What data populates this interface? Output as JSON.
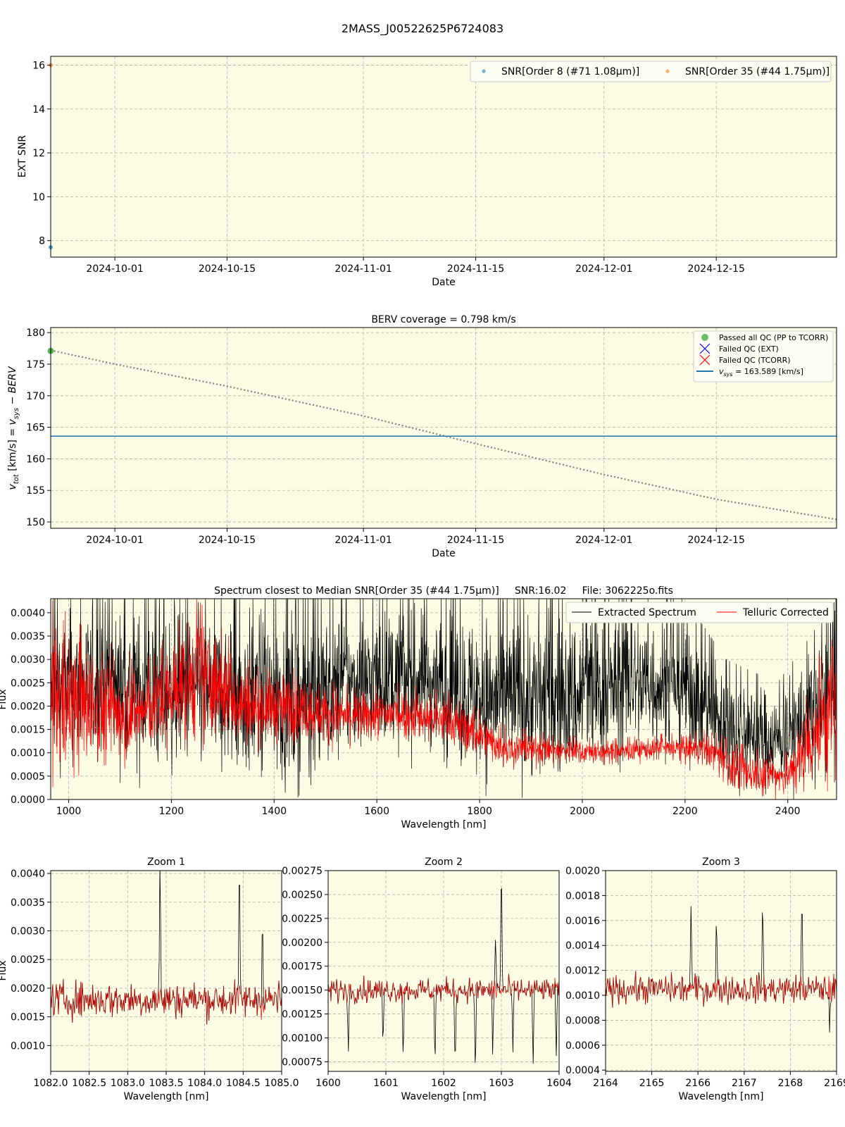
{
  "figure_title": "2MASS_J00522625P6724083",
  "colors": {
    "panel_bg": "#fcfbe3",
    "series_blue": "#1f77b4",
    "series_orange": "#ff7f0e",
    "spec_black": "#000000",
    "spec_red": "#ff0000",
    "grid": "#b0b0b0",
    "passed_green": "#2ca02c",
    "vsys_line": "#1f77b4",
    "berv_curve": "#808080"
  },
  "chart_data": [
    {
      "id": "snr",
      "type": "scatter",
      "title": "",
      "xlabel": "Date",
      "ylabel": "EXT SNR",
      "x_range": [
        "2024-09-23",
        "2024-12-30"
      ],
      "ylim": [
        7.25,
        16.4
      ],
      "x_ticks": [
        "2024-10-01",
        "2024-10-15",
        "2024-11-01",
        "2024-11-15",
        "2024-12-01",
        "2024-12-15"
      ],
      "y_ticks": [
        8,
        10,
        12,
        14,
        16
      ],
      "grid": true,
      "legend_position": "top-right",
      "series": [
        {
          "name": "SNR[Order 8 (#71 1.08μm)]",
          "color": "#1f77b4",
          "points": [
            {
              "x": "2024-09-23",
              "y": 7.7
            }
          ]
        },
        {
          "name": "SNR[Order 35 (#44 1.75μm)]",
          "color": "#ff7f0e",
          "points": [
            {
              "x": "2024-09-23",
              "y": 16.0
            }
          ]
        }
      ]
    },
    {
      "id": "berv",
      "type": "line",
      "title": "BERV coverage = 0.798 km/s",
      "xlabel": "Date",
      "ylabel": "v_tot [km/s] = v_sys − BERV",
      "x_range": [
        "2024-09-23",
        "2024-12-30"
      ],
      "ylim": [
        149,
        180.8
      ],
      "x_ticks": [
        "2024-10-01",
        "2024-10-15",
        "2024-11-01",
        "2024-11-15",
        "2024-12-01",
        "2024-12-15"
      ],
      "y_ticks": [
        150,
        155,
        160,
        165,
        170,
        175,
        180
      ],
      "grid": true,
      "legend_position": "top-right",
      "legend": [
        "Passed all QC (PP to TCORR)",
        "Failed QC (EXT)",
        "Failed QC (TCORR)",
        "v_sys = 163.589 [km/s]"
      ],
      "vsys": 163.589,
      "passed_points": [
        {
          "x": "2024-09-23",
          "y": 177.1
        }
      ],
      "berv_curve": [
        {
          "x": "2024-09-23",
          "y": 177.2
        },
        {
          "x": "2024-10-01",
          "y": 175.0
        },
        {
          "x": "2024-10-15",
          "y": 171.5
        },
        {
          "x": "2024-11-01",
          "y": 166.8
        },
        {
          "x": "2024-11-15",
          "y": 162.4
        },
        {
          "x": "2024-12-01",
          "y": 157.5
        },
        {
          "x": "2024-12-15",
          "y": 153.6
        },
        {
          "x": "2024-12-30",
          "y": 150.4
        }
      ]
    },
    {
      "id": "spectrum",
      "type": "line",
      "title": "Spectrum closest to Median SNR[Order 35 (#44 1.75μm)]     SNR:16.02     File: 3062225o.fits",
      "xlabel": "Wavelength [nm]",
      "ylabel": "Flux",
      "xlim": [
        965,
        2495
      ],
      "ylim": [
        0,
        0.0043
      ],
      "x_ticks": [
        1000,
        1200,
        1400,
        1600,
        1800,
        2000,
        2200,
        2400
      ],
      "y_ticks": [
        "0.0000",
        "0.0005",
        "0.0010",
        "0.0015",
        "0.0020",
        "0.0025",
        "0.0030",
        "0.0035",
        "0.0040"
      ],
      "grid": true,
      "legend_position": "top-right",
      "series": [
        {
          "name": "Extracted Spectrum",
          "color": "#000000",
          "envelope": [
            [
              965,
              0.0005,
              0.0043
            ],
            [
              1100,
              0.0006,
              0.0043
            ],
            [
              1150,
              0.0002,
              0.0043
            ],
            [
              1250,
              0.0004,
              0.0043
            ],
            [
              1350,
              0.0,
              0.0043
            ],
            [
              1450,
              0.0,
              0.0043
            ],
            [
              1520,
              0.0004,
              0.0043
            ],
            [
              1600,
              0.0008,
              0.0043
            ],
            [
              1700,
              0.0008,
              0.0043
            ],
            [
              1800,
              0.0,
              0.0043
            ],
            [
              1900,
              0.0,
              0.0043
            ],
            [
              2000,
              0.0001,
              0.0043
            ],
            [
              2100,
              0.0007,
              0.0043
            ],
            [
              2200,
              0.0006,
              0.0043
            ],
            [
              2280,
              0.0,
              0.003
            ],
            [
              2380,
              0.0,
              0.0025
            ],
            [
              2495,
              0.0,
              0.0043
            ]
          ]
        },
        {
          "name": "Telluric Corrected",
          "color": "#ff0000",
          "envelope": [
            [
              965,
              0.0,
              0.0043
            ],
            [
              1050,
              0.0004,
              0.0035
            ],
            [
              1150,
              0.0008,
              0.003
            ],
            [
              1250,
              0.001,
              0.0043
            ],
            [
              1350,
              0.001,
              0.003
            ],
            [
              1450,
              0.0011,
              0.0028
            ],
            [
              1550,
              0.0011,
              0.0024
            ],
            [
              1650,
              0.0012,
              0.0025
            ],
            [
              1750,
              0.001,
              0.0023
            ],
            [
              1850,
              0.0006,
              0.0016
            ],
            [
              1950,
              0.0007,
              0.0014
            ],
            [
              2050,
              0.0007,
              0.0013
            ],
            [
              2150,
              0.0008,
              0.0014
            ],
            [
              2250,
              0.0006,
              0.0015
            ],
            [
              2300,
              0.0,
              0.0012
            ],
            [
              2400,
              0.0,
              0.001
            ],
            [
              2495,
              0.0,
              0.0043
            ]
          ]
        }
      ]
    },
    {
      "id": "zoom1",
      "type": "line",
      "title": "Zoom 1",
      "xlabel": "Wavelength [nm]",
      "ylabel": "Flux",
      "xlim": [
        1082.0,
        1085.0
      ],
      "ylim": [
        0.00055,
        0.00405
      ],
      "x_ticks": [
        "1082.0",
        "1082.5",
        "1083.0",
        "1083.5",
        "1084.0",
        "1084.5",
        "1085.0"
      ],
      "y_ticks": [
        "0.0010",
        "0.0015",
        "0.0020",
        "0.0025",
        "0.0030",
        "0.0035",
        "0.0040"
      ],
      "grid": true,
      "baseline": 0.0018,
      "noise": 0.0003,
      "black_peaks": [
        [
          1083.42,
          0.0042
        ],
        [
          1084.45,
          0.0042
        ],
        [
          1084.75,
          0.0032
        ]
      ],
      "black_dips": []
    },
    {
      "id": "zoom2",
      "type": "line",
      "title": "Zoom 2",
      "xlabel": "Wavelength [nm]",
      "ylabel": "",
      "xlim": [
        1600,
        1604
      ],
      "ylim": [
        0.00065,
        0.00275
      ],
      "x_ticks": [
        "1600",
        "1601",
        "1602",
        "1603",
        "1604"
      ],
      "y_ticks": [
        "0.00075",
        "0.00100",
        "0.00125",
        "0.00150",
        "0.00175",
        "0.00200",
        "0.00225",
        "0.00250",
        "0.00275"
      ],
      "grid": true,
      "baseline": 0.0015,
      "noise": 0.00012,
      "black_peaks": [
        [
          1603.0,
          0.0028
        ],
        [
          1602.9,
          0.00205
        ]
      ],
      "black_dips": [
        [
          1600.35,
          0.00085
        ],
        [
          1600.95,
          0.00095
        ],
        [
          1601.3,
          0.00082
        ],
        [
          1601.85,
          0.00075
        ],
        [
          1602.2,
          0.00072
        ],
        [
          1602.55,
          0.00065
        ],
        [
          1602.85,
          0.00082
        ],
        [
          1603.2,
          0.00085
        ],
        [
          1603.55,
          0.00072
        ],
        [
          1603.95,
          0.0008
        ]
      ]
    },
    {
      "id": "zoom3",
      "type": "line",
      "title": "Zoom 3",
      "xlabel": "Wavelength [nm]",
      "ylabel": "",
      "xlim": [
        2164,
        2169
      ],
      "ylim": [
        0.00039,
        0.002
      ],
      "x_ticks": [
        "2164",
        "2165",
        "2166",
        "2167",
        "2168",
        "2169"
      ],
      "y_ticks": [
        "0.0004",
        "0.0006",
        "0.0008",
        "0.0010",
        "0.0012",
        "0.0014",
        "0.0016",
        "0.0018",
        "0.0020"
      ],
      "grid": true,
      "baseline": 0.00105,
      "noise": 0.00011,
      "black_peaks": [
        [
          2165.85,
          0.00172
        ],
        [
          2166.4,
          0.00162
        ],
        [
          2167.4,
          0.00175
        ],
        [
          2168.25,
          0.00178
        ]
      ],
      "black_dips": [
        [
          2168.85,
          0.0007
        ]
      ]
    }
  ]
}
